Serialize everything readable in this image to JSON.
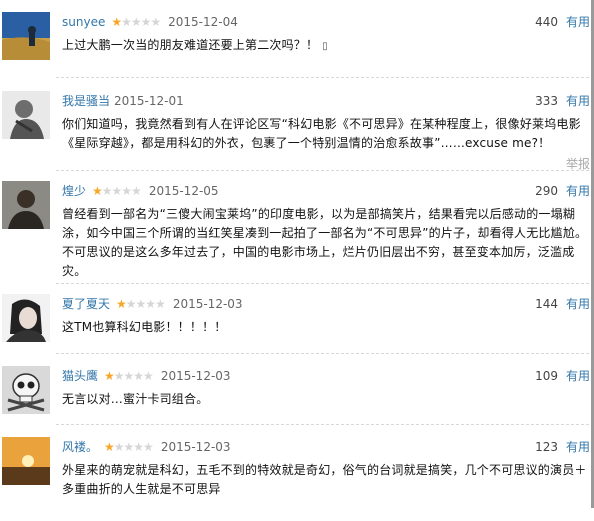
{
  "useful_label": "有用",
  "report_label": "举报",
  "comments": [
    {
      "user": "sunyee",
      "rating": 1,
      "date": "2015-12-04",
      "votes": "440",
      "text": "上过大鹏一次当的朋友难道还要上第二次吗？！",
      "avatar_icon": "landscape-avatar"
    },
    {
      "user": "我是骚当",
      "rating": null,
      "date": "2015-12-01",
      "votes": "333",
      "text": "你们知道吗，我竟然看到有人在评论区写“科幻电影《不可思异》在某种程度上，很像好莱坞电影《星际穿越》，都是用科幻的外衣，包裹了一个特别温情的治愈系故事”……excuse me?！",
      "avatar_icon": "statue-avatar"
    },
    {
      "user": "煌少",
      "rating": 1,
      "date": "2015-12-05",
      "votes": "290",
      "text": "曾经看到一部名为“三傻大闹宝莱坞”的印度电影，以为是部搞笑片，结果看完以后感动的一塌糊涂，如今中国三个所谓的当红笑星凑到一起拍了一部名为“不可思异”的片子，却看得人无比尴尬。不可思议的是这么多年过去了，中国的电影市场上，烂片仍旧层出不穷，甚至变本加厉，泛滥成灾。",
      "avatar_icon": "person-avatar"
    },
    {
      "user": "夏了夏天",
      "rating": 1,
      "date": "2015-12-03",
      "votes": "144",
      "text": "这TM也算科幻电影！！！！！",
      "avatar_icon": "girl-avatar"
    },
    {
      "user": "猫头鹰",
      "rating": 1,
      "date": "2015-12-03",
      "votes": "109",
      "text": "无言以对…蜜汁卡司组合。",
      "avatar_icon": "skull-avatar"
    },
    {
      "user": "风褛。",
      "rating": 1,
      "date": "2015-12-03",
      "votes": "123",
      "text": "外星来的萌宠就是科幻，五毛不到的特效就是奇幻，俗气的台词就是搞笑，几个不可思议的演员＋多重曲折的人生就是不可思异",
      "avatar_icon": "sunset-avatar"
    }
  ]
}
